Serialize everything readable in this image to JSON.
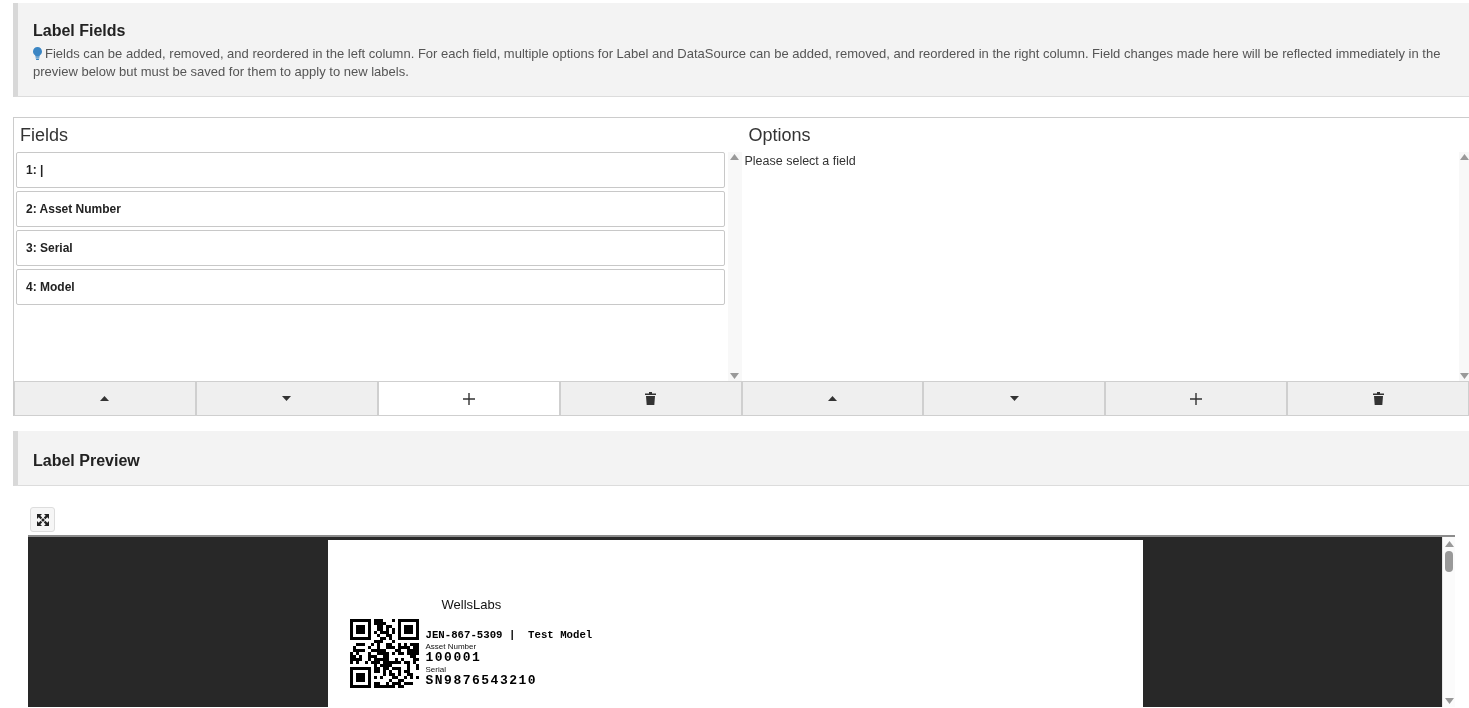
{
  "fields_panel": {
    "title": "Label Fields",
    "description": "Fields can be added, removed, and reordered in the left column. For each field, multiple options for Label and DataSource can be added, removed, and reordered in the right column. Field changes made here will be reflected immediately in the preview below but must be saved for them to apply to new labels."
  },
  "fields": {
    "title": "Fields",
    "items": [
      {
        "label": "1: |",
        "selected": false
      },
      {
        "label": "2: Asset Number",
        "selected": false
      },
      {
        "label": "3: Serial",
        "selected": false
      },
      {
        "label": "4: Model",
        "selected": false
      }
    ],
    "buttons": [
      {
        "kind": "up",
        "focused": false
      },
      {
        "kind": "down",
        "focused": false
      },
      {
        "kind": "add",
        "focused": true
      },
      {
        "kind": "delete",
        "focused": false
      }
    ]
  },
  "options": {
    "title": "Options",
    "message": "Please select a field",
    "buttons": [
      {
        "kind": "up",
        "focused": false
      },
      {
        "kind": "down",
        "focused": false
      },
      {
        "kind": "add",
        "focused": false
      },
      {
        "kind": "delete",
        "focused": false
      }
    ]
  },
  "preview_panel": {
    "title": "Label Preview"
  },
  "label": {
    "company": "WellsLabs",
    "line": "JEN-867-5309 |  Test Model",
    "fields": [
      {
        "caption": "Asset Number",
        "value": "100001"
      },
      {
        "caption": "Serial",
        "value": "SN9876543210"
      }
    ]
  }
}
